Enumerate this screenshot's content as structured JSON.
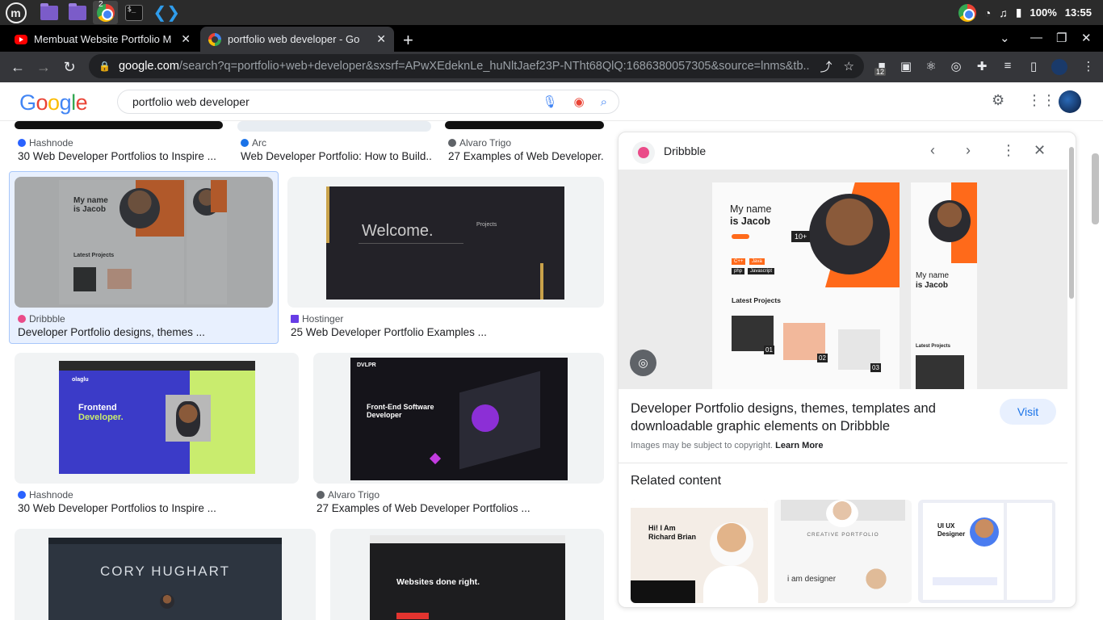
{
  "taskbar": {
    "apps": [
      "mint-menu",
      "files",
      "files-2",
      "chrome",
      "terminal",
      "vscode"
    ],
    "chrome_badge": "2",
    "battery": "100%",
    "clock": "13:55"
  },
  "tabs": [
    {
      "title": "Membuat Website Portfolio M",
      "favicon": "youtube"
    },
    {
      "title": "portfolio web developer - Go",
      "favicon": "google"
    }
  ],
  "omnibox": {
    "host": "google.com",
    "path": "/search?q=portfolio+web+developer&sxsrf=APwXEdeknLe_huNltJaef23P-NTht68QlQ:1686380057305&source=lnms&tb..."
  },
  "extensions": {
    "badge": "12"
  },
  "search": {
    "logo": [
      "G",
      "o",
      "o",
      "g",
      "l",
      "e"
    ],
    "query": "portfolio web developer"
  },
  "results": [
    {
      "source": "Hashnode",
      "title": "30 Web Developer Portfolios to Inspire ...",
      "source_color": "#2962ff"
    },
    {
      "source": "Arc",
      "title": "Web Developer Portfolio: How to Build...",
      "source_color": "#1a73e8"
    },
    {
      "source": "Alvaro Trigo",
      "title": "27 Examples of Web Developer...",
      "source_color": "#5f6368"
    },
    {
      "source": "Dribbble",
      "title": "Developer Portfolio designs, themes ...",
      "source_color": "#ea4c89"
    },
    {
      "source": "Hostinger",
      "title": "25 Web Developer Portfolio Examples ...",
      "source_color": "#673de6"
    },
    {
      "source": "Hashnode",
      "title": "30 Web Developer Portfolios to Inspire ...",
      "source_color": "#2962ff"
    },
    {
      "source": "Alvaro Trigo",
      "title": "27 Examples of Web Developer Portfolios ...",
      "source_color": "#5f6368"
    }
  ],
  "thumbs": {
    "jacob_name_1": "My name",
    "jacob_name_2": "is Jacob",
    "jacob_latest": "Latest Projects",
    "welcome": "Welcome.",
    "projects": "Projects",
    "frontend_1": "Frontend",
    "frontend_2": "Developer.",
    "frontend_logo": "olaglu",
    "dvlpr": "DVLPR",
    "fe_software_1": "Front-End Software",
    "fe_software_2": "Developer",
    "cory": "CORY HUGHART",
    "websites": "Websites done right."
  },
  "panel": {
    "site": "Dribbble",
    "title": "Developer Portfolio designs, themes, templates and downloadable graphic elements on Dribbble",
    "visit": "Visit",
    "copyright": "Images may be subject to copyright.",
    "learn_more": "Learn More",
    "related_heading": "Related content",
    "preview": {
      "name_1": "My name",
      "name_2": "is Jacob",
      "badge": "10+",
      "latest": "Latest Projects",
      "tag_cpp": "C++",
      "tag_java": "Java",
      "tag_php": "php",
      "tag_js": "Javascript",
      "n1": "01",
      "n2": "02",
      "n3": "03"
    },
    "related": [
      {
        "line1": "Hi! I Am",
        "line2": "Richard Brian"
      },
      {
        "line1": "CREATIVE PORTFOLIO",
        "line2": "i am designer"
      },
      {
        "line1": "UI UX",
        "line2": "Designer"
      }
    ]
  },
  "colors": {
    "accent": "#1a73e8",
    "orange": "#ff6a1a",
    "dribbble": "#ea4c89"
  }
}
